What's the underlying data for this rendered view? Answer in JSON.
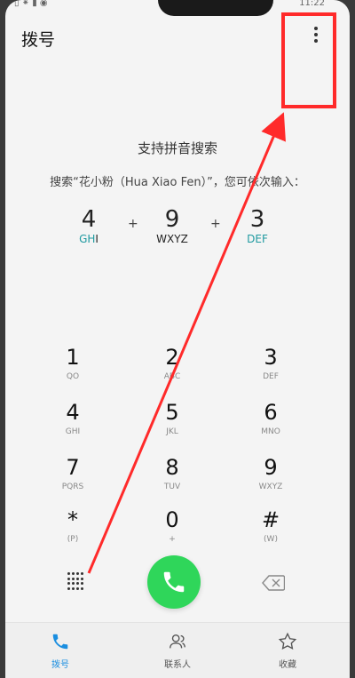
{
  "status": {
    "left": "▯ ⁕ ▮ ◉",
    "time": "11:22"
  },
  "header": {
    "title": "拨号"
  },
  "hint": {
    "title": "支持拼音搜索",
    "subtitle": "搜索“花小粉（Hua Xiao Fen）”，您可依次输入："
  },
  "pinyin_example": [
    {
      "digit": "4",
      "hl": "GH",
      "rest": "I"
    },
    {
      "digit": "9",
      "hl": "X",
      "rest": "WXYZ"
    },
    {
      "digit": "3",
      "hl": "",
      "rest": "DEF"
    }
  ],
  "pinyin_plus": "+",
  "keypad": [
    {
      "digit": "1",
      "sub": "QO"
    },
    {
      "digit": "2",
      "sub": "ABC"
    },
    {
      "digit": "3",
      "sub": "DEF"
    },
    {
      "digit": "4",
      "sub": "GHI"
    },
    {
      "digit": "5",
      "sub": "JKL"
    },
    {
      "digit": "6",
      "sub": "MNO"
    },
    {
      "digit": "7",
      "sub": "PQRS"
    },
    {
      "digit": "8",
      "sub": "TUV"
    },
    {
      "digit": "9",
      "sub": "WXYZ"
    },
    {
      "digit": "*",
      "sub": "(P)"
    },
    {
      "digit": "0",
      "sub": "+"
    },
    {
      "digit": "#",
      "sub": "(W)"
    }
  ],
  "bottom_nav": [
    {
      "label": "拨号",
      "icon": "phone-icon",
      "active": true
    },
    {
      "label": "联系人",
      "icon": "contacts-icon",
      "active": false
    },
    {
      "label": "收藏",
      "icon": "star-icon",
      "active": false
    }
  ],
  "colors": {
    "call": "#2fd65a",
    "accent": "#1a8ee0",
    "annotation": "#ff2a2a",
    "pinyin_highlight": "#1f9aa0"
  }
}
